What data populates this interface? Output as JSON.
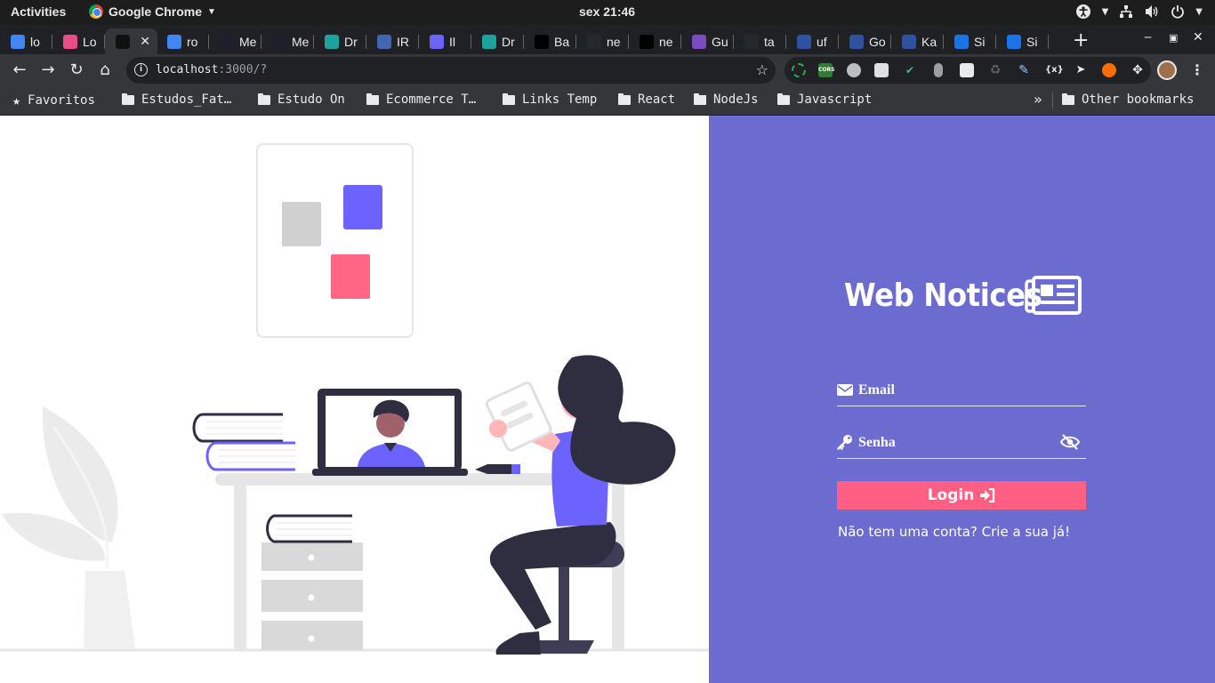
{
  "system_bar": {
    "activities": "Activities",
    "app_name": "Google Chrome",
    "clock": "sex 21:46"
  },
  "tabs": [
    {
      "label": "lo",
      "favicon": "google-icon",
      "color": "#4285f4"
    },
    {
      "label": "Lo",
      "favicon": "dribbble-icon",
      "color": "#ea4c89"
    },
    {
      "label": "",
      "favicon": "triangle-icon",
      "color": "#111111",
      "active": true
    },
    {
      "label": "ro",
      "favicon": "google-icon",
      "color": "#4285f4"
    },
    {
      "label": "Me",
      "favicon": "figma-slash-icon",
      "color": "#1e1e2e"
    },
    {
      "label": "Me",
      "favicon": "figma-slash-icon",
      "color": "#1e1e2e"
    },
    {
      "label": "Dr",
      "favicon": "circle-icon",
      "color": "#1ba39c"
    },
    {
      "label": "IR",
      "favicon": "play-icon",
      "color": "#4267b2"
    },
    {
      "label": "Il",
      "favicon": "illustration-icon",
      "color": "#6c63ff"
    },
    {
      "label": "Dr",
      "favicon": "circle-icon",
      "color": "#1ba39c"
    },
    {
      "label": "Ba",
      "favicon": "next-icon",
      "color": "#000000"
    },
    {
      "label": "ne",
      "favicon": "github-icon",
      "color": "#24292e"
    },
    {
      "label": "ne",
      "favicon": "next-icon",
      "color": "#000000"
    },
    {
      "label": "Gu",
      "favicon": "fox-icon",
      "color": "#7b4bc4"
    },
    {
      "label": "ta",
      "favicon": "github-icon",
      "color": "#24292e"
    },
    {
      "label": "uf",
      "favicon": "mal-icon",
      "color": "#2e51a2"
    },
    {
      "label": "Go",
      "favicon": "mal-icon",
      "color": "#2e51a2"
    },
    {
      "label": "Ka",
      "favicon": "mal-icon",
      "color": "#2e51a2"
    },
    {
      "label": "Si",
      "favicon": "flag-icon",
      "color": "#1a73e8"
    },
    {
      "label": "Si",
      "favicon": "flag-icon",
      "color": "#1a73e8"
    }
  ],
  "toolbar": {
    "url_host": "localhost",
    "url_path": ":3000/?"
  },
  "bookmarks": {
    "favorites": "Favoritos",
    "items": [
      "Estudos_Fat…",
      "Estudo On",
      "Ecommerce T…",
      "Links Temp",
      "React",
      "NodeJs",
      "Javascript"
    ],
    "more": "»",
    "other": "Other bookmarks"
  },
  "login": {
    "app_title": "Web Notices",
    "email_placeholder": "Email",
    "password_placeholder": "Senha",
    "login_label": "Login",
    "signup_text": "Não tem uma conta? Crie a sua já!"
  },
  "colors": {
    "panel": "#6c6bcf",
    "login_button": "#ff5f83",
    "illustration_accent": "#6c63ff",
    "illustration_dark": "#2f2e41"
  }
}
